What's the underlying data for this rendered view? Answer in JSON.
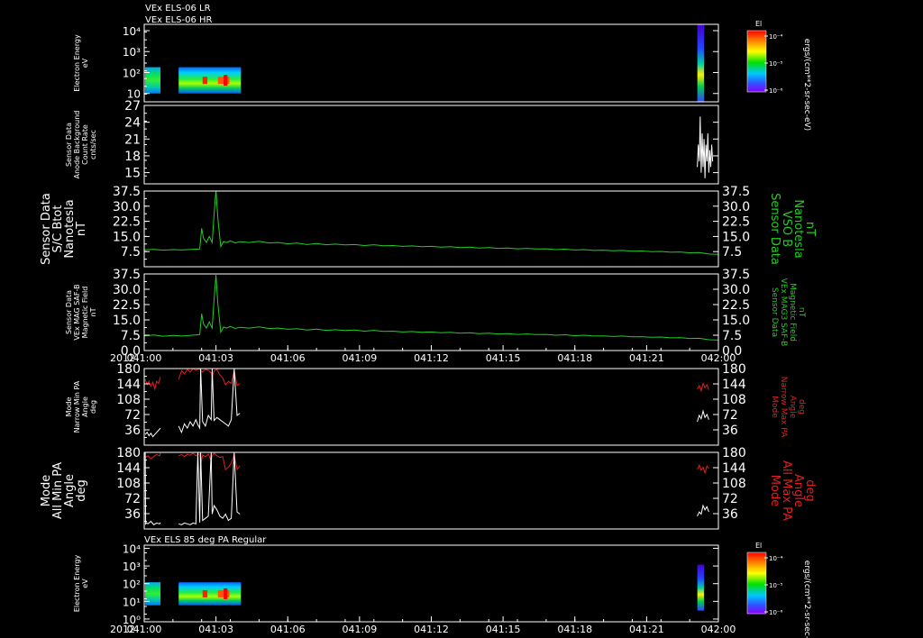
{
  "header": {
    "line1": "VEx ELS-06 LR",
    "line2": "VEx ELS-06 HR"
  },
  "x_axis": {
    "ticks": [
      "041:00",
      "041:03",
      "041:06",
      "041:09",
      "041:12",
      "041:15",
      "041:18",
      "041:21",
      "042:00"
    ],
    "year_label": "2012"
  },
  "colorbar": {
    "title": "El",
    "ticks": [
      "10⁻⁴",
      "10⁻⁵",
      "10⁻⁶"
    ],
    "unit": "ergs/(cm**2-sr-sec-eV)"
  },
  "colors": {
    "green": "#22cc22",
    "red": "#e02020",
    "white": "#ffffff",
    "background": "#000000"
  },
  "chart_data": [
    {
      "type": "heatmap",
      "panel": "p1",
      "ylabel": [
        "Electron Energy",
        "eV"
      ],
      "ylabel_style": "small",
      "yscale": "log",
      "yticks": [
        {
          "v": 10,
          "l": "10"
        },
        {
          "v": 100,
          "l": "10²"
        },
        {
          "v": 1000,
          "l": "10³"
        },
        {
          "v": 10000,
          "l": "10⁴"
        }
      ],
      "ylim": [
        4,
        20000
      ],
      "xlim": [
        0,
        60
      ],
      "segments": [
        {
          "x0": 0.1,
          "x1": 1.7,
          "y0": 10,
          "y1": 180,
          "style": "lr"
        },
        {
          "x0": 3.6,
          "x1": 10.1,
          "y0": 10,
          "y1": 180,
          "style": "hr",
          "hot": [
            6.1,
            8.9
          ]
        },
        {
          "x0": 57.8,
          "x1": 58.5,
          "y0": 4,
          "y1": 19000,
          "style": "tail"
        }
      ]
    },
    {
      "type": "line",
      "panel": "p2",
      "ylabel": [
        "Sensor Data",
        "Anode Background",
        "Count Rate",
        "cnts/sec"
      ],
      "ylabel_style": "small",
      "yticks": [
        {
          "v": 15,
          "l": "15"
        },
        {
          "v": 18,
          "l": "18"
        },
        {
          "v": 21,
          "l": "21"
        },
        {
          "v": 24,
          "l": "24"
        },
        {
          "v": 27,
          "l": "27"
        }
      ],
      "ylim": [
        13,
        27
      ],
      "xlim": [
        0,
        60
      ],
      "series": [
        {
          "color": "white",
          "x": [
            57.8,
            57.9,
            58.0,
            58.1,
            58.2,
            58.3,
            58.4,
            58.5,
            58.6,
            58.7,
            58.8,
            58.9,
            59.0,
            59.1,
            59.2,
            59.3,
            59.4
          ],
          "y": [
            16,
            20,
            17,
            25,
            15,
            22,
            16,
            21,
            14,
            20,
            17,
            22,
            15,
            19,
            16,
            20,
            17
          ]
        }
      ]
    },
    {
      "type": "line",
      "panel": "p3",
      "ylabel": [
        "Sensor Data",
        "S/C Btot",
        "Nanotesla",
        "nT"
      ],
      "ylabel_style": "large",
      "ylabel_right": [
        "Sensor Data",
        "VSO B",
        "Nanotesla",
        "nT"
      ],
      "right_color": "green",
      "yticks": [
        {
          "v": 7.5,
          "l": "7.5"
        },
        {
          "v": 15,
          "l": "15.0"
        },
        {
          "v": 22.5,
          "l": "22.5"
        },
        {
          "v": 30,
          "l": "30.0"
        },
        {
          "v": 37.5,
          "l": "37.5"
        }
      ],
      "ylim": [
        0,
        37.5
      ],
      "xlim": [
        0,
        60
      ],
      "series": [
        {
          "color": "green",
          "x": [
            0,
            1,
            2,
            3,
            4,
            5,
            5.8,
            6.0,
            6.2,
            6.5,
            6.8,
            7.1,
            7.3,
            7.5,
            7.7,
            8.0,
            8.3,
            8.6,
            9.0,
            9.5,
            10,
            11,
            12,
            13,
            14,
            15,
            16,
            17,
            18,
            19,
            20,
            21,
            22,
            23,
            24,
            25,
            26,
            27,
            28,
            29,
            30,
            31,
            32,
            33,
            34,
            35,
            36,
            37,
            38,
            39,
            40,
            41,
            42,
            43,
            44,
            45,
            46,
            47,
            48,
            49,
            50,
            51,
            52,
            53,
            54,
            55,
            56,
            57,
            58,
            59,
            60
          ],
          "y": [
            8.4,
            8.6,
            8.2,
            8.5,
            8.3,
            8.6,
            8.8,
            19,
            14,
            12,
            15,
            12,
            26,
            38,
            24,
            10,
            12.5,
            12,
            12.8,
            11.8,
            12.4,
            12,
            12.6,
            11.8,
            12,
            11.4,
            11.7,
            11,
            11.5,
            10.9,
            11.2,
            10.8,
            11,
            10.5,
            10.9,
            10.4,
            10.5,
            10.1,
            10.3,
            9.9,
            10.1,
            9.7,
            9.9,
            9.5,
            9.7,
            9.3,
            9.5,
            9.1,
            9.3,
            8.9,
            9.1,
            8.8,
            8.9,
            8.5,
            8.7,
            8.3,
            8.5,
            8.1,
            8.2,
            7.9,
            8.1,
            7.7,
            7.8,
            7.5,
            7.6,
            7.2,
            7.3,
            6.9,
            7,
            6.3,
            6.1
          ]
        }
      ]
    },
    {
      "type": "line",
      "panel": "p4",
      "ylabel": [
        "Sensor Data",
        "VEx MAG SAF-B",
        "Magnetic Field",
        "nT"
      ],
      "ylabel_style": "small",
      "ylabel_right": [
        "Sensor Data",
        "VEx MAG3 SAF-B",
        "Magnetic Field",
        "nT"
      ],
      "right_color": "green",
      "yticks": [
        {
          "v": 0,
          "l": "0.0"
        },
        {
          "v": 7.5,
          "l": "7.5"
        },
        {
          "v": 15,
          "l": "15.0"
        },
        {
          "v": 22.5,
          "l": "22.5"
        },
        {
          "v": 30,
          "l": "30.0"
        },
        {
          "v": 37.5,
          "l": "37.5"
        }
      ],
      "ylim": [
        0,
        37.5
      ],
      "xlim": [
        0,
        60
      ],
      "series": [
        {
          "color": "green",
          "x": [
            0,
            1,
            2,
            3,
            4,
            5,
            5.8,
            6.0,
            6.2,
            6.5,
            6.8,
            7.1,
            7.3,
            7.5,
            7.7,
            8.0,
            8.3,
            8.6,
            9.0,
            9.5,
            10,
            11,
            12,
            13,
            14,
            15,
            16,
            17,
            18,
            19,
            20,
            21,
            22,
            23,
            24,
            25,
            26,
            27,
            28,
            29,
            30,
            31,
            32,
            33,
            34,
            35,
            36,
            37,
            38,
            39,
            40,
            41,
            42,
            43,
            44,
            45,
            46,
            47,
            48,
            49,
            50,
            51,
            52,
            53,
            54,
            55,
            56,
            57,
            58,
            59,
            60
          ],
          "y": [
            7.2,
            7.6,
            7,
            7.4,
            7.1,
            7.5,
            7.8,
            18,
            13,
            11,
            14,
            11,
            25,
            37,
            23,
            9,
            11.5,
            11,
            11.8,
            10.8,
            11.4,
            11,
            11.6,
            10.8,
            11,
            10.4,
            10.7,
            10,
            10.5,
            9.9,
            10.2,
            9.8,
            10,
            9.5,
            9.9,
            9.4,
            9.5,
            9.1,
            9.3,
            8.9,
            9.1,
            8.7,
            8.9,
            8.5,
            8.7,
            8.3,
            8.5,
            8.1,
            8.3,
            7.9,
            8.1,
            7.8,
            7.9,
            7.5,
            7.7,
            7.3,
            7.5,
            7.1,
            7.2,
            6.9,
            7.1,
            6.7,
            6.8,
            6.5,
            6.6,
            6.2,
            6.3,
            5.9,
            6,
            5.3,
            5.1
          ]
        }
      ]
    },
    {
      "type": "line",
      "panel": "p5",
      "ylabel": [
        "Mode",
        "Narrow Min PA",
        "Angle",
        "deg"
      ],
      "ylabel_style": "small",
      "ylabel_right": [
        "Mode",
        "Narrow Max PA",
        "Angle",
        "deg"
      ],
      "right_color": "red",
      "yticks": [
        {
          "v": 36,
          "l": "36"
        },
        {
          "v": 72,
          "l": "72"
        },
        {
          "v": 108,
          "l": "108"
        },
        {
          "v": 144,
          "l": "144"
        },
        {
          "v": 180,
          "l": "180"
        }
      ],
      "ylim": [
        0,
        180
      ],
      "xlim": [
        0,
        60
      ],
      "series": [
        {
          "color": "red",
          "x": [
            0.1,
            0.3,
            0.5,
            0.7,
            0.9,
            1.1,
            1.3,
            1.5,
            1.7
          ],
          "y": [
            155,
            142,
            150,
            138,
            148,
            132,
            150,
            145,
            160
          ]
        },
        {
          "color": "white",
          "x": [
            0.1,
            0.3,
            0.5,
            0.7,
            0.9,
            1.1,
            1.3,
            1.5,
            1.7
          ],
          "y": [
            25,
            30,
            22,
            28,
            20,
            25,
            30,
            35,
            40
          ]
        },
        {
          "color": "red",
          "x": [
            3.6,
            3.9,
            4.2,
            4.5,
            4.8,
            5.1,
            5.4,
            5.6,
            5.8,
            5.9,
            6.1,
            6.4,
            6.7,
            7.0,
            7.1,
            7.3,
            7.6,
            7.9,
            8.2,
            8.5,
            8.8,
            9.1,
            9.4,
            9.7,
            10.0
          ],
          "y": [
            155,
            175,
            168,
            178,
            172,
            180,
            176,
            178,
            180,
            175,
            172,
            178,
            176,
            170,
            160,
            174,
            178,
            165,
            158,
            142,
            150,
            145,
            175,
            140,
            145
          ]
        },
        {
          "color": "white",
          "x": [
            3.6,
            3.9,
            4.2,
            4.5,
            4.8,
            5.1,
            5.4,
            5.6,
            5.8,
            5.9,
            6.1,
            6.4,
            6.7,
            7.0,
            7.1,
            7.3,
            7.6,
            7.9,
            8.2,
            8.5,
            8.8,
            9.1,
            9.4,
            9.7,
            10.0
          ],
          "y": [
            45,
            30,
            50,
            40,
            55,
            45,
            60,
            48,
            40,
            180,
            55,
            45,
            70,
            60,
            180,
            58,
            65,
            60,
            55,
            50,
            45,
            60,
            180,
            70,
            75
          ]
        },
        {
          "color": "red",
          "x": [
            57.8,
            58.0,
            58.2,
            58.4,
            58.6,
            58.8,
            59.0
          ],
          "y": [
            132,
            140,
            128,
            145,
            135,
            142,
            130
          ]
        },
        {
          "color": "white",
          "x": [
            57.8,
            58.0,
            58.2,
            58.4,
            58.6,
            58.8,
            59.0
          ],
          "y": [
            55,
            70,
            62,
            80,
            65,
            72,
            60
          ]
        }
      ]
    },
    {
      "type": "line",
      "panel": "p6",
      "ylabel": [
        "Mode",
        "All Min PA",
        "Angle",
        "deg"
      ],
      "ylabel_style": "large",
      "ylabel_right": [
        "Mode",
        "All Max PA",
        "Angle",
        "deg"
      ],
      "right_color": "red",
      "yticks": [
        {
          "v": 36,
          "l": "36"
        },
        {
          "v": 72,
          "l": "72"
        },
        {
          "v": 108,
          "l": "108"
        },
        {
          "v": 144,
          "l": "144"
        },
        {
          "v": 180,
          "l": "180"
        }
      ],
      "ylim": [
        0,
        180
      ],
      "xlim": [
        0,
        60
      ],
      "series": [
        {
          "color": "red",
          "x": [
            0.1,
            0.4,
            0.7,
            1.0,
            1.3,
            1.6,
            1.7
          ],
          "y": [
            168,
            172,
            165,
            170,
            175,
            172,
            178
          ]
        },
        {
          "color": "white",
          "x": [
            0.1,
            0.15,
            0.2,
            0.4,
            0.7,
            1.0,
            1.3,
            1.6,
            1.7
          ],
          "y": [
            180,
            10,
            15,
            12,
            18,
            10,
            14,
            12,
            15
          ]
        },
        {
          "color": "red",
          "x": [
            3.6,
            3.9,
            4.2,
            4.5,
            4.8,
            5.1,
            5.4,
            5.6,
            5.8,
            5.9,
            6.1,
            6.4,
            6.7,
            7.0,
            7.1,
            7.3,
            7.6,
            7.9,
            8.2,
            8.5,
            8.8,
            9.1,
            9.4,
            9.7,
            10.0
          ],
          "y": [
            172,
            175,
            170,
            176,
            173,
            178,
            172,
            175,
            176,
            150,
            174,
            170,
            176,
            160,
            172,
            178,
            172,
            168,
            170,
            140,
            145,
            155,
            175,
            140,
            148
          ]
        },
        {
          "color": "white",
          "x": [
            3.6,
            3.9,
            4.2,
            4.5,
            4.8,
            5.1,
            5.4,
            5.6,
            5.8,
            5.9,
            6.1,
            6.4,
            6.7,
            7.0,
            7.1,
            7.3,
            7.6,
            7.9,
            8.2,
            8.5,
            8.8,
            9.1,
            9.4,
            9.7,
            10.0
          ],
          "y": [
            12,
            10,
            14,
            12,
            10,
            14,
            12,
            180,
            15,
            180,
            20,
            25,
            30,
            180,
            35,
            55,
            45,
            30,
            25,
            35,
            20,
            25,
            180,
            40,
            35
          ]
        },
        {
          "color": "red",
          "x": [
            57.8,
            58.0,
            58.2,
            58.4,
            58.6,
            58.8,
            59.0
          ],
          "y": [
            140,
            150,
            138,
            145,
            132,
            148,
            142
          ]
        },
        {
          "color": "white",
          "x": [
            57.8,
            58.0,
            58.2,
            58.4,
            58.6,
            58.8,
            59.0
          ],
          "y": [
            30,
            40,
            35,
            55,
            45,
            52,
            40
          ]
        }
      ]
    },
    {
      "type": "heatmap",
      "panel": "p7",
      "title": "VEx ELS 85 deg PA Regular",
      "ylabel": [
        "Electron Energy",
        "eV"
      ],
      "ylabel_style": "small",
      "yscale": "log",
      "yticks": [
        {
          "v": 1,
          "l": "10⁰"
        },
        {
          "v": 10,
          "l": "10¹"
        },
        {
          "v": 100,
          "l": "10²"
        },
        {
          "v": 1000,
          "l": "10³"
        },
        {
          "v": 10000,
          "l": "10⁴"
        }
      ],
      "ylim": [
        0.7,
        15000
      ],
      "xlim": [
        0,
        60
      ],
      "segments": [
        {
          "x0": 0.1,
          "x1": 1.7,
          "y0": 6,
          "y1": 120,
          "style": "lr"
        },
        {
          "x0": 3.6,
          "x1": 10.1,
          "y0": 6,
          "y1": 120,
          "style": "hr",
          "hot": [
            6.1,
            8.9
          ]
        },
        {
          "x0": 57.8,
          "x1": 58.5,
          "y0": 3,
          "y1": 1200,
          "style": "tail"
        }
      ]
    }
  ]
}
